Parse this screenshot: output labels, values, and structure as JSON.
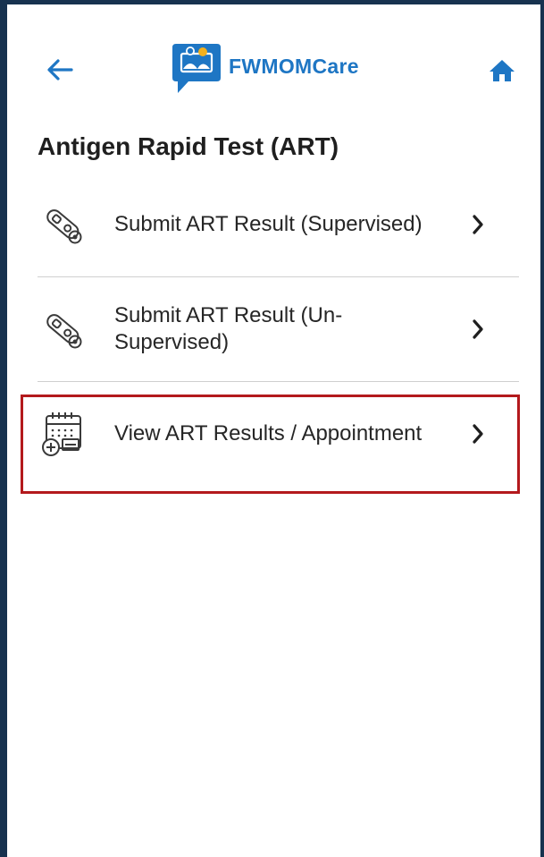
{
  "header": {
    "app_name": "FWMOMCare",
    "back_icon": "arrow-left-icon",
    "home_icon": "home-icon",
    "brand_color": "#1e76c4"
  },
  "page": {
    "title": "Antigen Rapid Test (ART)"
  },
  "menu": {
    "items": [
      {
        "label": "Submit ART Result (Supervised)",
        "icon": "test-kit-icon",
        "chevron": "chevron-right-icon"
      },
      {
        "label": "Submit ART Result (Un-Supervised)",
        "icon": "test-kit-icon",
        "chevron": "chevron-right-icon"
      },
      {
        "label": "View ART Results / Appointment",
        "icon": "calendar-medical-icon",
        "chevron": "chevron-right-icon",
        "highlighted": true
      }
    ]
  },
  "colors": {
    "frame": "#17324f",
    "highlight_border": "#b3191c",
    "divider": "#cfcfcf"
  }
}
